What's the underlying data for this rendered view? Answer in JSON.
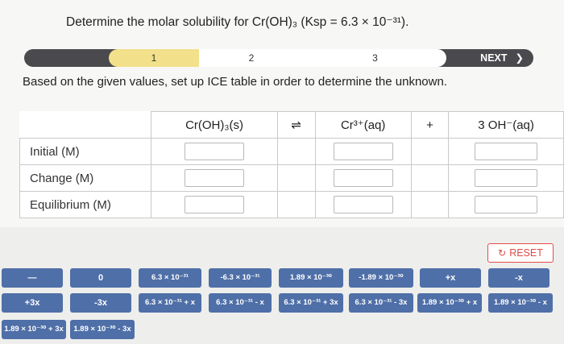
{
  "question": "Determine the molar solubility for Cr(OH)₃ (Ksp = 6.3 × 10⁻³¹).",
  "steps": {
    "step1": "1",
    "step2": "2",
    "step3": "3",
    "next_label": "NEXT",
    "next_chevron": "❯",
    "current_step": 1
  },
  "instruction": "Based on the given values, set up ICE table in order to determine the unknown.",
  "ice_table": {
    "headers": [
      "Cr(OH)₃(s)",
      "⇌",
      "Cr³⁺(aq)",
      "+",
      "3 OH⁻(aq)"
    ],
    "rows": [
      "Initial (M)",
      "Change (M)",
      "Equilibrium (M)"
    ]
  },
  "reset_label": "RESET",
  "tiles_row1": [
    "—",
    "0",
    "6.3 × 10⁻³¹",
    "-6.3 × 10⁻³¹",
    "1.89 × 10⁻³⁰",
    "-1.89 × 10⁻³⁰",
    "+x",
    "-x"
  ],
  "tiles_row2": [
    "+3x",
    "-3x",
    "6.3 × 10⁻³¹ + x",
    "6.3 × 10⁻³¹ - x",
    "6.3 × 10⁻³¹ + 3x",
    "6.3 × 10⁻³¹ - 3x",
    "1.89 × 10⁻³⁰ + x",
    "1.89 × 10⁻³⁰ - x"
  ],
  "tiles_row3": [
    "1.89 × 10⁻³⁰ + 3x",
    "1.89 × 10⁻³⁰ - 3x"
  ],
  "colors": {
    "tile": "#4f6fa8",
    "accent": "#f2e08a",
    "reset": "#e34c4c",
    "stepbar": "#4a4a4e"
  }
}
